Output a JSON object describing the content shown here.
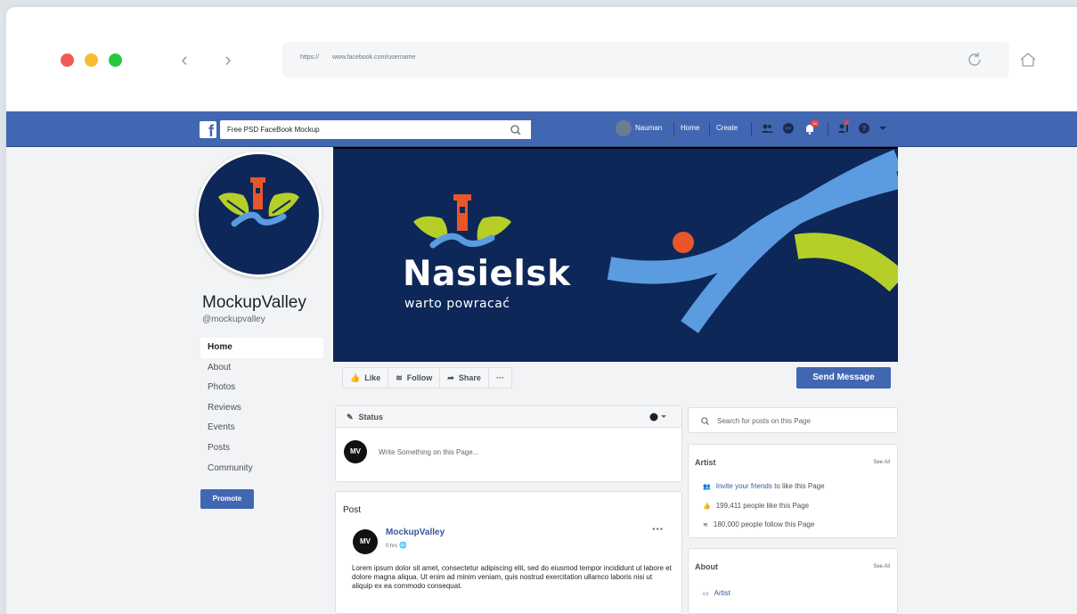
{
  "browser": {
    "url_scheme": "https://",
    "url_rest": "www.facebook.com/username"
  },
  "fb_bar": {
    "search_value": "Free PSD FaceBook Mockup",
    "user_name": "Nauman",
    "home": "Home",
    "create": "Create",
    "notification_count": "14"
  },
  "page": {
    "name": "MockupValley",
    "handle": "@mockupvalley",
    "nav": [
      "Home",
      "About",
      "Photos",
      "Reviews",
      "Events",
      "Posts",
      "Community"
    ],
    "promote": "Promote"
  },
  "cover": {
    "brand": "Nasielsk",
    "tagline": "warto powracać"
  },
  "actions": {
    "like": "Like",
    "follow": "Follow",
    "share": "Share",
    "more": "···",
    "send_message": "Send Message"
  },
  "status": {
    "title": "Status",
    "placeholder": "Write Something on this Page..."
  },
  "post": {
    "section_label": "Post",
    "author": "MockupValley",
    "time": "0 hrs",
    "avatar_text": "MV",
    "text": "Lorem ipsum dolor sit amet, consectetur adipiscing elit, sed do eiusmod tempor incididunt ut labore et dolore magna aliqua. Ut enim ad minim veniam, quis nostrud exercitation ullamco laboris nisi ut aliquip ex ea commodo consequat."
  },
  "right": {
    "search_placeholder": "Search for posts on this Page",
    "artist_title": "Artist",
    "see_all": "See All",
    "invite_link": "Invite your friends",
    "invite_rest": "to like this Page",
    "likes": "199,411 people like this Page",
    "follows": "180,000 people follow this Page",
    "about_title": "About",
    "about_item": "Artist"
  },
  "colors": {
    "fb_blue": "#4267b2",
    "cover_navy": "#0d2758",
    "river_blue": "#5b9be0",
    "leaf_green": "#b5cf28",
    "sun_orange": "#e8562a"
  }
}
